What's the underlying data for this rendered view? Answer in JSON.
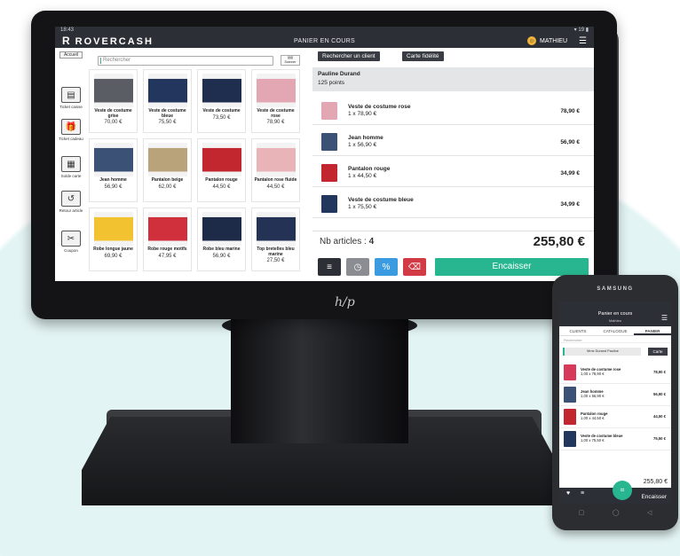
{
  "statusbar": {
    "time": "18:43",
    "right": "▾ 19 ▮"
  },
  "topbar": {
    "brand": "ROVERCASH",
    "title": "PANIER EN COURS",
    "user": "MATHIEU"
  },
  "left": {
    "accueil": "Accueil",
    "search_placeholder": "Rechercher",
    "scan": "Scanner",
    "side": [
      {
        "label": "Ticket caisse",
        "icon": "receipt-icon",
        "glyph": "▤"
      },
      {
        "label": "Ticket cadeau",
        "icon": "gift-icon",
        "glyph": "🎁"
      },
      {
        "label": "Solde carte",
        "icon": "card-balance-icon",
        "glyph": "▦"
      },
      {
        "label": "Retour article",
        "icon": "return-icon",
        "glyph": "↺"
      },
      {
        "label": "Coupon",
        "icon": "coupon-icon",
        "glyph": "✂"
      }
    ]
  },
  "products": [
    {
      "name": "Veste de costume grise",
      "price": "70,00 €",
      "color": "#5a5d63"
    },
    {
      "name": "Veste de costume bleue",
      "price": "75,50 €",
      "color": "#23365e"
    },
    {
      "name": "Veste de costume",
      "price": "73,50 €",
      "color": "#1f2d4f"
    },
    {
      "name": "Veste de costume rose",
      "price": "78,90 €",
      "color": "#e3a7b4"
    },
    {
      "name": "Jean homme",
      "price": "56,90 €",
      "color": "#3b5175"
    },
    {
      "name": "Pantalon beige",
      "price": "62,00 €",
      "color": "#b9a37a"
    },
    {
      "name": "Pantalon rouge",
      "price": "44,50 €",
      "color": "#c2262e"
    },
    {
      "name": "Pantalon rose fluide",
      "price": "44,50 €",
      "color": "#e8b4b8"
    },
    {
      "name": "Robe longue jaune",
      "price": "69,90 €",
      "color": "#f2c230"
    },
    {
      "name": "Robe rouge motifs",
      "price": "47,95 €",
      "color": "#d0303c"
    },
    {
      "name": "Robe bleu marine",
      "price": "56,90 €",
      "color": "#1d2a48"
    },
    {
      "name": "Top bretelles bleu marine",
      "price": "27,50 €",
      "color": "#243255"
    }
  ],
  "right": {
    "btn_client": "Rechercher un client",
    "btn_fidelite": "Carte fidélité",
    "client_name": "Pauline Durand",
    "client_points": "125 points",
    "cart": [
      {
        "name": "Veste de costume rose",
        "qty": "1 x 78,90 €",
        "amount": "78,90 €",
        "color": "#e3a7b4"
      },
      {
        "name": "Jean homme",
        "qty": "1 x 56,90 €",
        "amount": "56,90 €",
        "color": "#3b5175"
      },
      {
        "name": "Pantalon rouge",
        "qty": "1 x 44,50 €",
        "amount": "34,99 €",
        "color": "#c2262e"
      },
      {
        "name": "Veste de costume bleue",
        "qty": "1 x 75,50 €",
        "amount": "34,99 €",
        "color": "#23365e"
      }
    ],
    "nb_label": "Nb articles :",
    "nb_value": "4",
    "total": "255,80 €",
    "encaisser": "Encaisser"
  },
  "phone": {
    "brand": "SAMSUNG",
    "title": "Panier en cours",
    "subtitle": "Mathieu",
    "tabs": [
      "CLIENTS",
      "CATALOGUE",
      "PANIER"
    ],
    "search": "Rechercher",
    "client": "Mme Durand Pauline",
    "client_btn": "Carte",
    "items": [
      {
        "name": "Veste de costume rose",
        "qty": "1,00 x 78,90 €",
        "amount": "78,90 €",
        "color": "#d7395a"
      },
      {
        "name": "Jean homme",
        "qty": "1,00 x 56,90 €",
        "amount": "56,90 €",
        "color": "#3b5175"
      },
      {
        "name": "Pantalon rouge",
        "qty": "1,00 x 44,50 €",
        "amount": "44,50 €",
        "color": "#c2262e"
      },
      {
        "name": "Veste de costume bleue",
        "qty": "1,00 x 75,50 €",
        "amount": "75,50 €",
        "color": "#23365e"
      }
    ],
    "total": "255,80 €",
    "encaisser": "Encaisser"
  },
  "colors": {
    "accent": "#27b68f",
    "dark": "#2d2f36",
    "clock": "#8b8d93",
    "discount": "#3a9be0",
    "delete": "#d23b45"
  }
}
